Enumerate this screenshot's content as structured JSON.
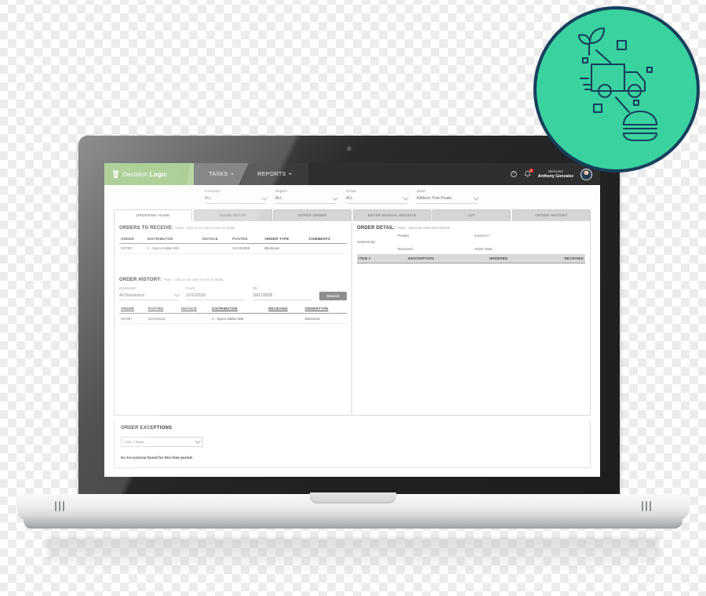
{
  "app": {
    "brand": {
      "first": "Decision",
      "second": "Logic",
      "icon": "cup-logo-icon"
    },
    "nav": [
      {
        "label": "TASKS",
        "name": "nav-tasks"
      },
      {
        "label": "REPORTS",
        "name": "nav-reports"
      }
    ],
    "nav_right": {
      "help_icon": "question-mark-icon",
      "bell_icon": "notification-bell-icon",
      "bell_count": "5",
      "welcome_line1": "Welcome",
      "welcome_line2": "Anthony Gonzalez",
      "avatar": "user-avatar"
    },
    "filters": [
      {
        "label": "Company:",
        "value": "ALL"
      },
      {
        "label": "Region:",
        "value": "ALL"
      },
      {
        "label": "Group:",
        "value": "ALL"
      },
      {
        "label": "Store:",
        "value": "Addison Twin Peaks"
      }
    ],
    "tabs": [
      {
        "label": "ORDERING HOME",
        "active": true
      },
      {
        "label": "GUIDE SETUP",
        "active": false
      },
      {
        "label": "ENTER ORDER",
        "active": false
      },
      {
        "label": "ENTER MANUAL RECEIVE",
        "active": false
      },
      {
        "label": "IUT",
        "active": false
      },
      {
        "label": "ORDER HISTORY",
        "active": false
      }
    ],
    "orders_to_receive": {
      "title": "ORDERS TO RECEIVE:",
      "note": "*Note - click on an order to see its detail.",
      "columns": [
        "ORDER",
        "DISTRIBUTOR",
        "INVOICE",
        "POSTED",
        "ORDER TYPE",
        "COMMENTS"
      ],
      "rows": [
        {
          "order": "257097",
          "distributor": "1 - Sysco Dallas 006",
          "invoice": "",
          "posted": "10/10/2016",
          "order_type": "Electronic",
          "comments": ""
        }
      ]
    },
    "order_detail": {
      "title": "ORDER DETAIL:",
      "note": "*Note - select an order from the left.",
      "posted_label": "Posted -",
      "invoice_label": "Invoice # -",
      "ordered_by_label": "Ordered By:",
      "received_label": "Received -",
      "order_total_label": "Order Total -",
      "columns": [
        "ITEM #",
        "DESCRIPTION",
        "ORDERED",
        "RECEIVED"
      ],
      "rows": []
    },
    "order_history": {
      "title": "ORDER HISTORY:",
      "note": "*Note - click on an order to see its detail.",
      "distributor_label": "Distributor:",
      "distributor_value": "All Distributors",
      "from_label": "From:",
      "from_value": "10/10/2016",
      "to_label": "To:",
      "to_value": "10/17/2016",
      "search_label": "Search",
      "columns": [
        "ORDER",
        "POSTED",
        "INVOICE",
        "DISTRIBUTOR",
        "RECEIVED",
        "ORDERTYPE"
      ],
      "rows": [
        {
          "order": "257097",
          "posted": "10/10/2016",
          "invoice": "",
          "distributor": "1 - Sysco Dallas 006",
          "received": "",
          "ordertype": "Electronic"
        }
      ]
    },
    "order_exceptions": {
      "title": "ORDER EXCEPTIONS",
      "range_value": "Last 7 Days",
      "empty_message": "No Exceptions found for this time period."
    }
  },
  "badge": {
    "name": "delivery-badge",
    "icons": [
      "delivery-truck-icon",
      "plant-sprout-icon",
      "burger-icon"
    ],
    "fill": "#3ad29f",
    "stroke": "#16405c"
  },
  "device": {
    "name": "laptop-mockup"
  }
}
